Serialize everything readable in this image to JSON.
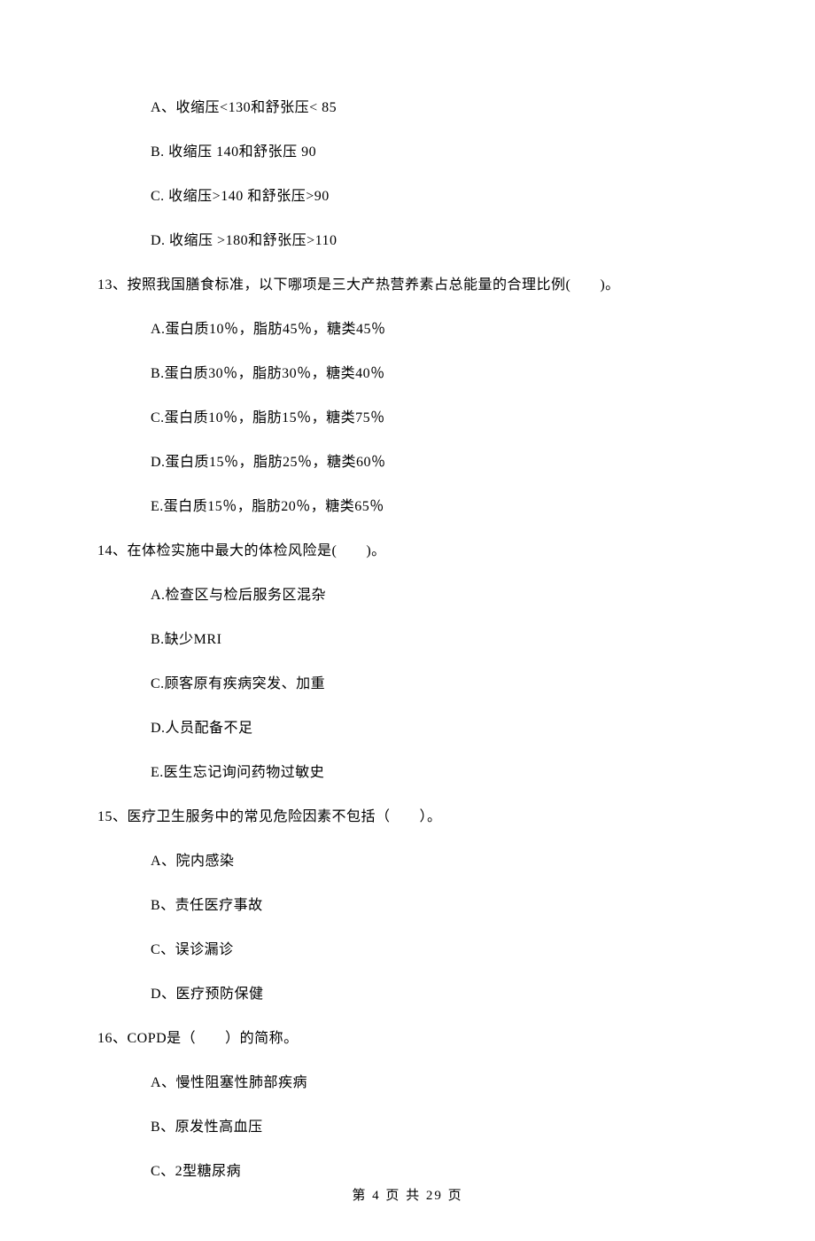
{
  "q12": {
    "options": {
      "A": "A、收缩压<130和舒张压< 85",
      "B": "B. 收缩压 140和舒张压 90",
      "C": "C. 收缩压>140 和舒张压>90",
      "D": "D. 收缩压 >180和舒张压>110"
    }
  },
  "q13": {
    "stem": "13、按照我国膳食标准，以下哪项是三大产热营养素占总能量的合理比例(　　)。",
    "options": {
      "A": "A.蛋白质10％，脂肪45％，糖类45％",
      "B": "B.蛋白质30％，脂肪30％，糖类40％",
      "C": "C.蛋白质10％，脂肪15％，糖类75％",
      "D": "D.蛋白质15％，脂肪25％，糖类60％",
      "E": "E.蛋白质15％，脂肪20％，糖类65％"
    }
  },
  "q14": {
    "stem": "14、在体检实施中最大的体检风险是(　　)。",
    "options": {
      "A": "A.检查区与检后服务区混杂",
      "B": "B.缺少MRI",
      "C": "C.顾客原有疾病突发、加重",
      "D": "D.人员配备不足",
      "E": "E.医生忘记询问药物过敏史"
    }
  },
  "q15": {
    "stem": "15、医疗卫生服务中的常见危险因素不包括（　　）。",
    "options": {
      "A": "A、院内感染",
      "B": "B、责任医疗事故",
      "C": "C、误诊漏诊",
      "D": "D、医疗预防保健"
    }
  },
  "q16": {
    "stem": "16、COPD是（　　）的简称。",
    "options": {
      "A": "A、慢性阻塞性肺部疾病",
      "B": "B、原发性高血压",
      "C": "C、2型糖尿病"
    }
  },
  "footer": "第 4 页 共 29 页"
}
